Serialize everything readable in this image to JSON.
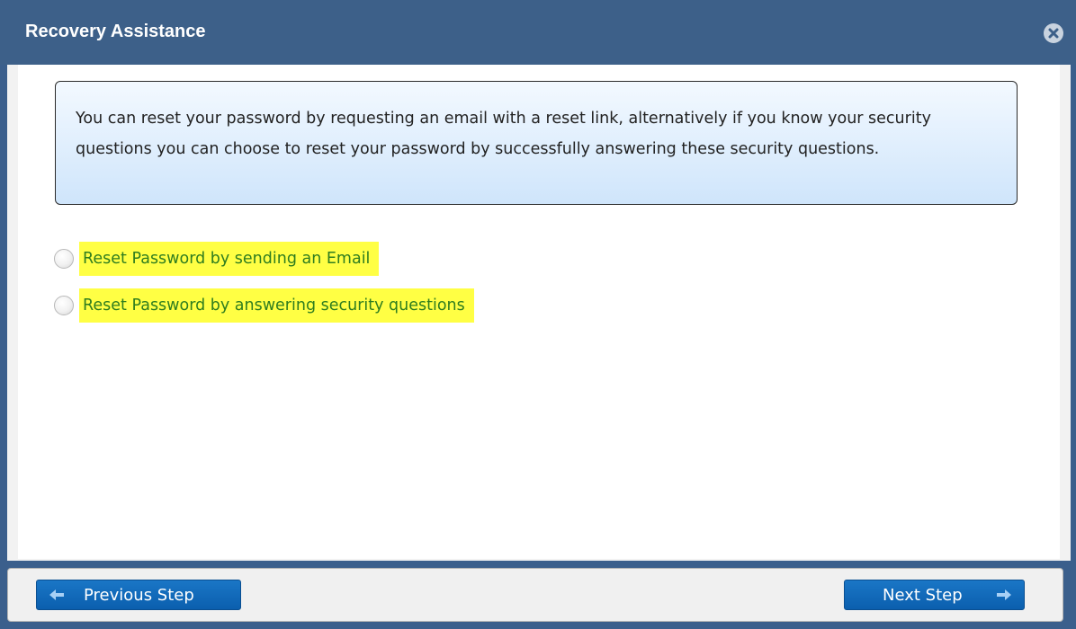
{
  "dialog": {
    "title": "Recovery Assistance",
    "close_icon": "close-circle-icon"
  },
  "info": {
    "text": "You can reset your password by requesting an email with a reset link, alternatively if you know your security questions you can choose to reset your password by successfully answering these security questions."
  },
  "options": [
    {
      "label": "Reset Password by sending an Email",
      "selected": false
    },
    {
      "label": "Reset Password by answering security questions",
      "selected": false
    }
  ],
  "footer": {
    "previous_label": "Previous Step",
    "next_label": "Next Step",
    "previous_icon": "arrow-left-icon",
    "next_icon": "arrow-right-icon"
  },
  "colors": {
    "titlebar": "#3d6089",
    "highlight": "#ffff44",
    "option_text": "#2f7d1f",
    "button": "#0f67b8"
  }
}
